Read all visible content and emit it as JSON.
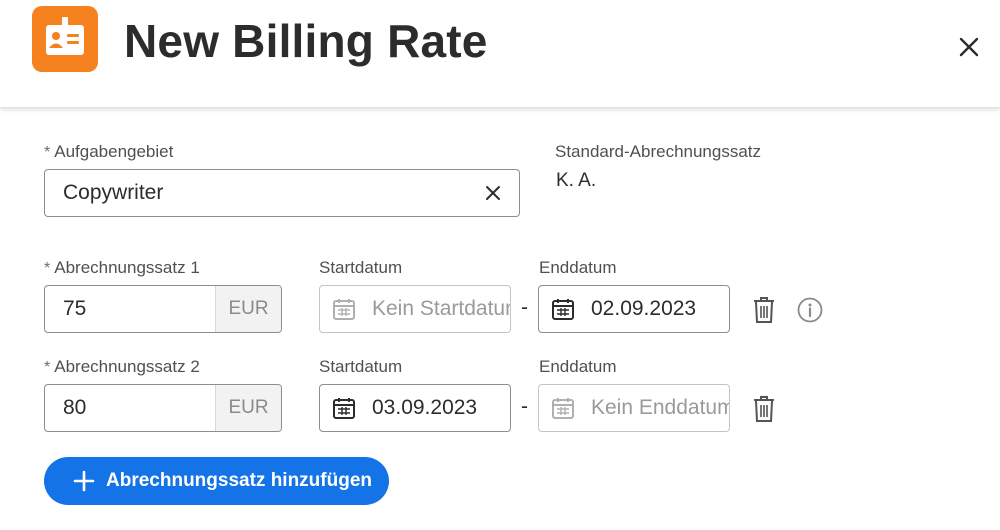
{
  "header": {
    "title": "New Billing Rate",
    "app_icon": "badge-icon",
    "accent_color": "#f5821f"
  },
  "job_role": {
    "required_marker": "*",
    "label": "Aufgabengebiet",
    "value": "Copywriter"
  },
  "default_rate": {
    "label": "Standard-Abrechnungssatz",
    "value": "K. A."
  },
  "rates": [
    {
      "required_marker": "*",
      "label": "Abrechnungssatz 1",
      "amount": "75",
      "currency": "EUR",
      "start_label": "Startdatum",
      "start_value": "",
      "start_placeholder": "Kein Startdatum",
      "separator": "-",
      "end_label": "Enddatum",
      "end_value": "02.09.2023",
      "end_placeholder": ""
    },
    {
      "required_marker": "*",
      "label": "Abrechnungssatz 2",
      "amount": "80",
      "currency": "EUR",
      "start_label": "Startdatum",
      "start_value": "03.09.2023",
      "start_placeholder": "",
      "separator": "-",
      "end_label": "Enddatum",
      "end_value": "",
      "end_placeholder": "Kein Enddatum"
    }
  ],
  "add_button": {
    "label": "Abrechnungssatz hinzufügen",
    "color": "#1473e6"
  }
}
